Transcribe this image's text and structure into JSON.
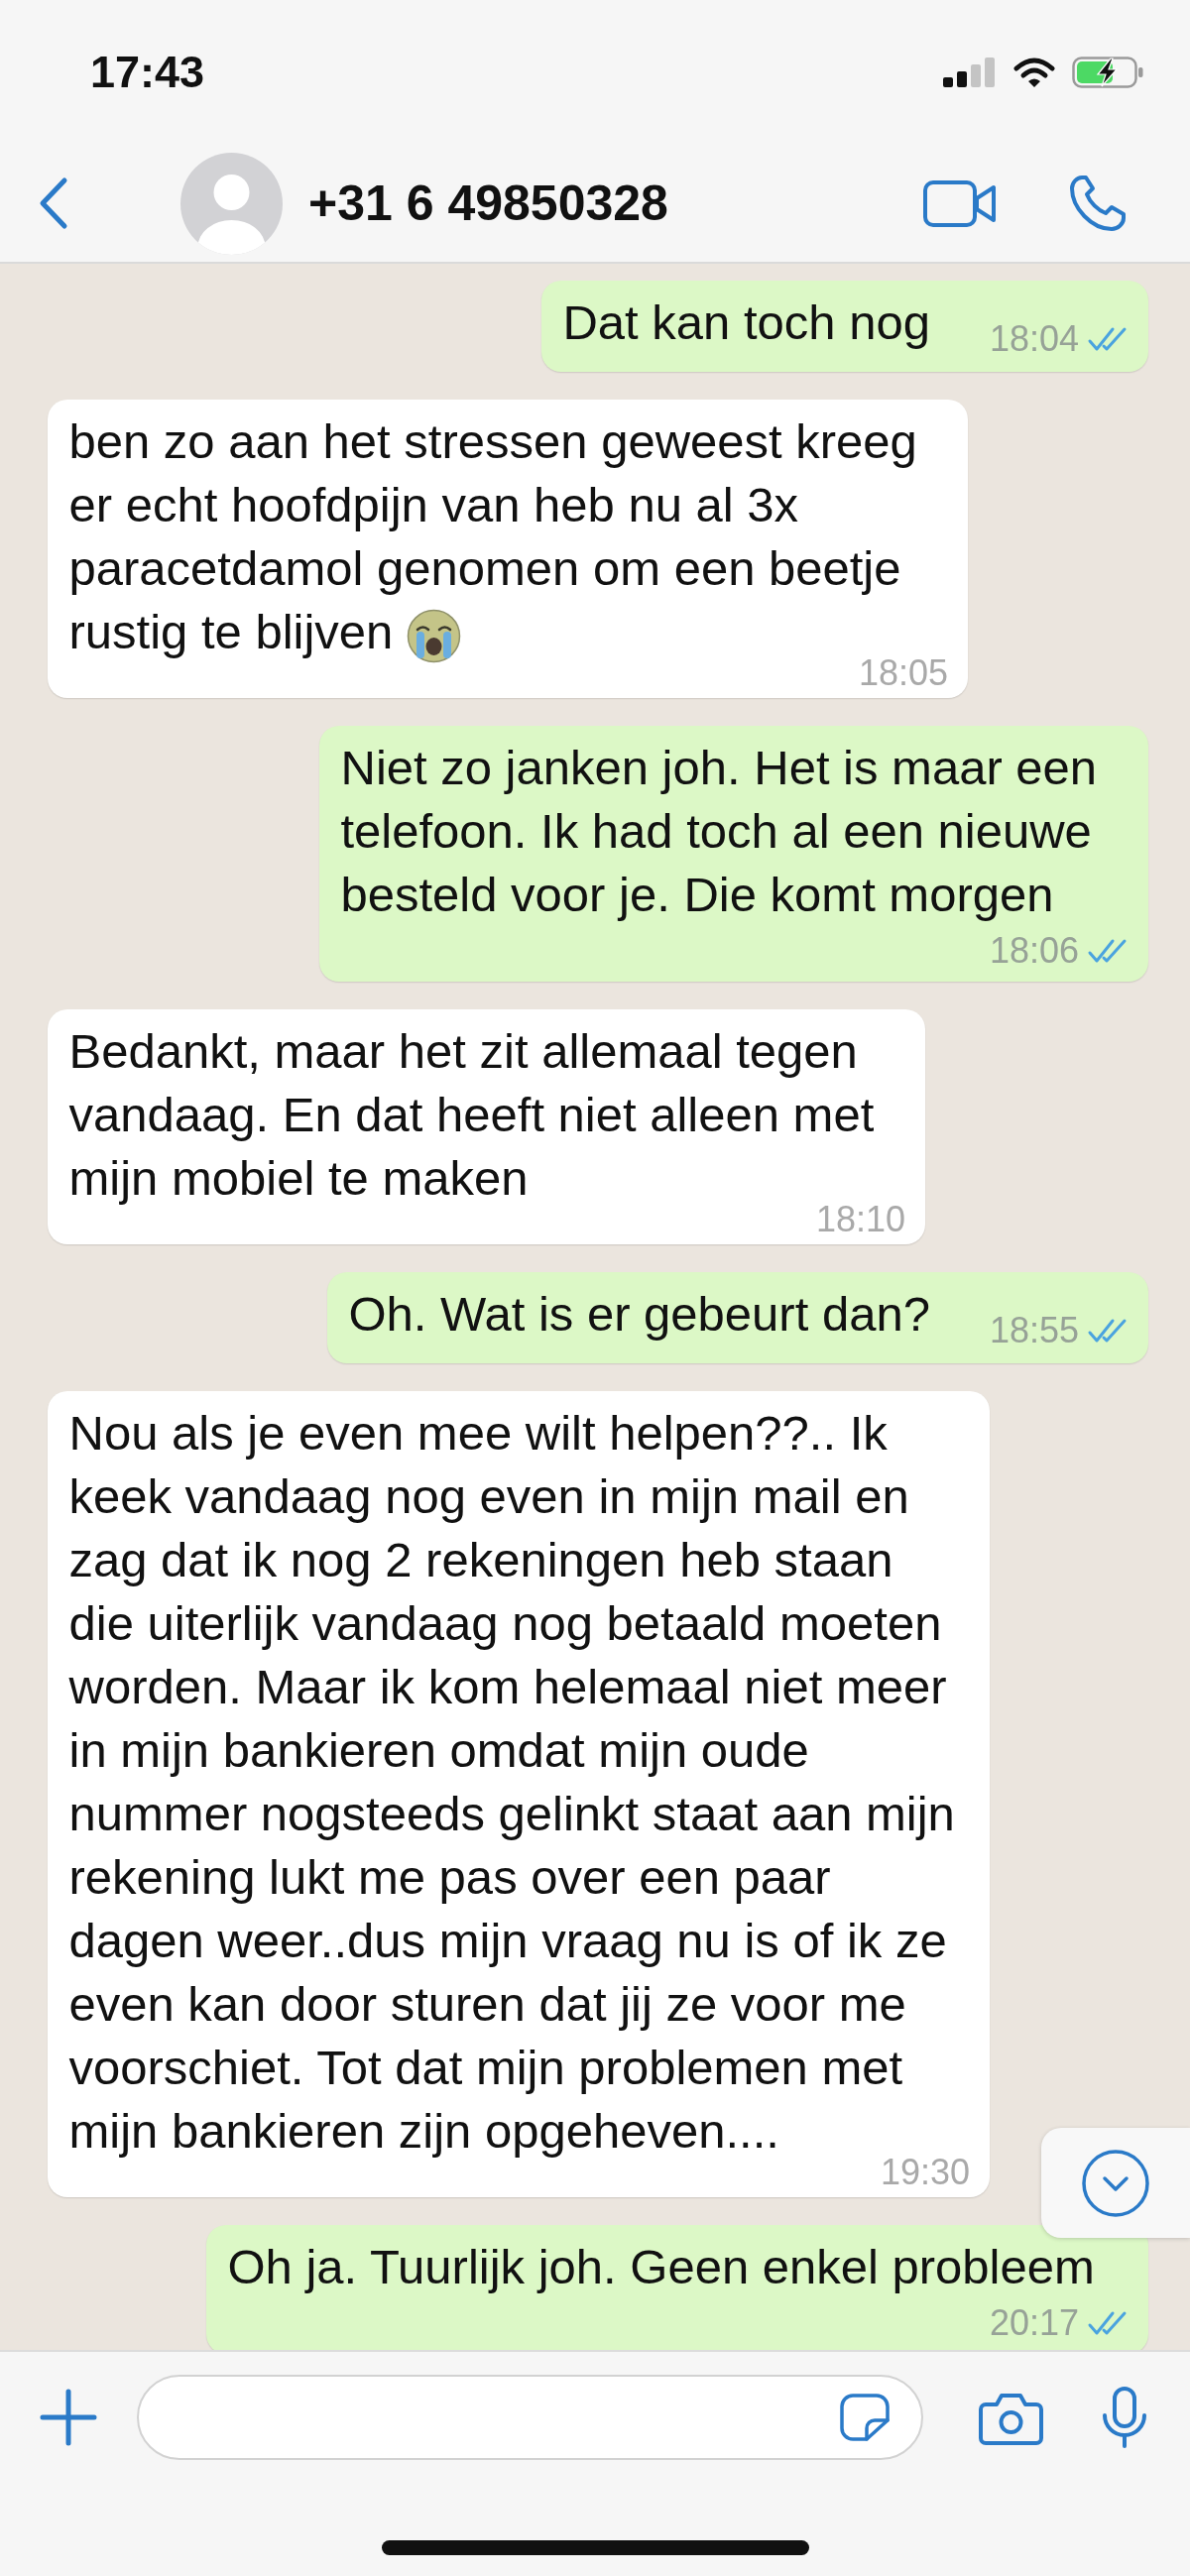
{
  "status_bar": {
    "time": "17:43"
  },
  "header": {
    "title": "+31 6 49850328"
  },
  "messages": [
    {
      "kind": "outgoing",
      "text": "Dat kan toch nog",
      "emoji": false,
      "time": "18:04",
      "read": true
    },
    {
      "kind": "incoming",
      "text": "ben zo aan het stressen geweest kreeg er echt hoofdpijn van heb nu al 3x paracetdamol genomen om een beetje rustig te blijven",
      "emoji": true,
      "time": "18:05"
    },
    {
      "kind": "outgoing",
      "text": "Niet zo janken joh. Het is maar een telefoon. Ik had toch al een nieuwe besteld voor je. Die komt morgen",
      "emoji": false,
      "time": "18:06",
      "read": true
    },
    {
      "kind": "incoming",
      "text": "Bedankt, maar het zit allemaal tegen vandaag. En dat heeft niet alleen met mijn mobiel te maken",
      "emoji": false,
      "time": "18:10"
    },
    {
      "kind": "outgoing",
      "text": "Oh. Wat is er gebeurt dan?",
      "emoji": false,
      "time": "18:55",
      "read": true
    },
    {
      "kind": "incoming",
      "text": "Nou als je even mee wilt helpen??.. Ik keek vandaag nog even in mijn mail en zag dat ik nog 2 rekeningen heb staan die uiterlijk vandaag nog betaald moeten worden. Maar ik kom helemaal niet meer in mijn bankieren omdat mijn oude nummer nogsteeds gelinkt staat aan mijn rekening lukt me pas over een paar dagen weer..dus mijn vraag nu is of ik ze even kan door sturen dat jij ze voor me voorschiet. Tot dat mijn problemen met mijn bankieren zijn opgeheven....",
      "emoji": false,
      "time": "19:30"
    },
    {
      "kind": "outgoing",
      "text": "Oh ja. Tuurlijk joh. Geen enkel probleem",
      "emoji": false,
      "time": "20:17",
      "read": true
    }
  ]
}
